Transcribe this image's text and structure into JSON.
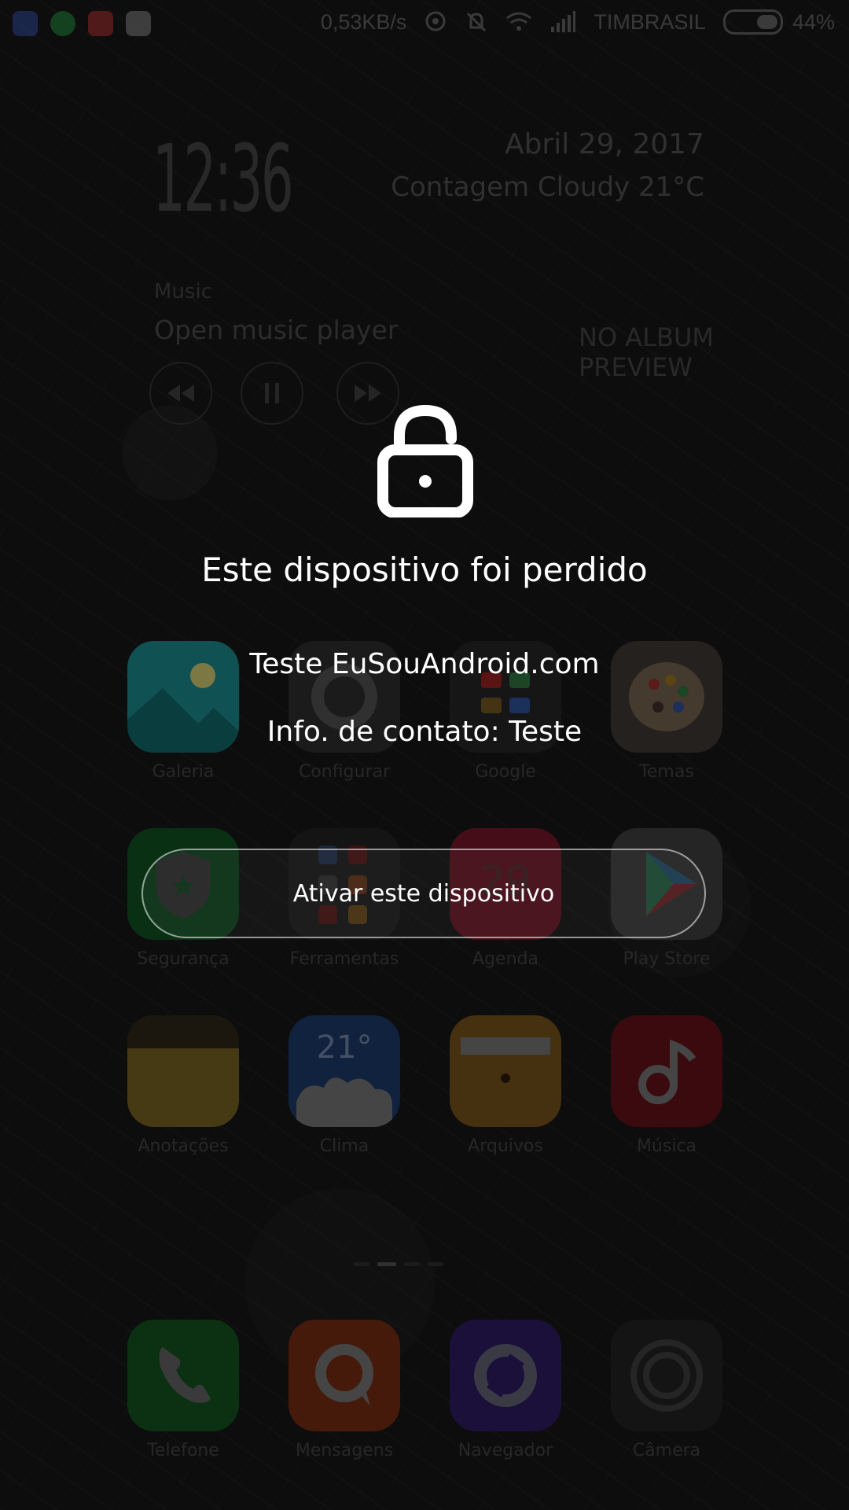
{
  "status_bar": {
    "net_speed": "0,53KB/s",
    "carrier": "TIMBRASIL",
    "battery": "44%",
    "battery_level": 0.44,
    "notification_apps": [
      "app-icon",
      "whatsapp-icon",
      "gmail-icon",
      "store-icon"
    ]
  },
  "clock_widget": {
    "time": "12:36",
    "date": "Abril 29, 2017",
    "weather": "Contagem Cloudy 21°C"
  },
  "music_widget": {
    "label": "Music",
    "title": "Open music player",
    "album_placeholder_line1": "NO ALBUM",
    "album_placeholder_line2": "PREVIEW"
  },
  "apps": [
    {
      "label": "Galeria",
      "icon": "gallery-icon",
      "color": "#1c9a9a"
    },
    {
      "label": "Configurar",
      "icon": "settings-icon",
      "color": "#6a6a6a"
    },
    {
      "label": "Google",
      "icon": "google-folder-icon",
      "color": "#5a5a5a"
    },
    {
      "label": "Temas",
      "icon": "themes-icon",
      "color": "#e0d0c0"
    },
    {
      "label": "Segurança",
      "icon": "security-icon",
      "color": "#1e8a3a"
    },
    {
      "label": "Ferramentas",
      "icon": "tools-folder-icon",
      "color": "#5a5a5a"
    },
    {
      "label": "Agenda",
      "icon": "calendar-icon",
      "color": "#d22a4a"
    },
    {
      "label": "Play Store",
      "icon": "play-store-icon",
      "color": "#eeeeee"
    },
    {
      "label": "Anotações",
      "icon": "notes-icon",
      "color": "#f3c93a"
    },
    {
      "label": "Clima",
      "icon": "weather-icon",
      "color": "#2f6fd0"
    },
    {
      "label": "Arquivos",
      "icon": "files-icon",
      "color": "#f0b22e"
    },
    {
      "label": "Música",
      "icon": "music-icon",
      "color": "#d0283a"
    }
  ],
  "clima_icon_text": "21°",
  "agenda_icon_text": "29",
  "dock": [
    {
      "label": "Telefone",
      "icon": "phone-icon",
      "color": "#2c9b3a"
    },
    {
      "label": "Mensagens",
      "icon": "messages-icon",
      "color": "#f05a22"
    },
    {
      "label": "Navegador",
      "icon": "browser-icon",
      "color": "#5a3ad0"
    },
    {
      "label": "Câmera",
      "icon": "camera-icon",
      "color": "#4a4a4a"
    }
  ],
  "lost_device": {
    "title": "Este dispositivo foi perdido",
    "message": "Teste EuSouAndroid.com",
    "contact": "Info. de contato: Teste",
    "button": "Ativar este dispositivo",
    "icon": "unlock-icon"
  }
}
